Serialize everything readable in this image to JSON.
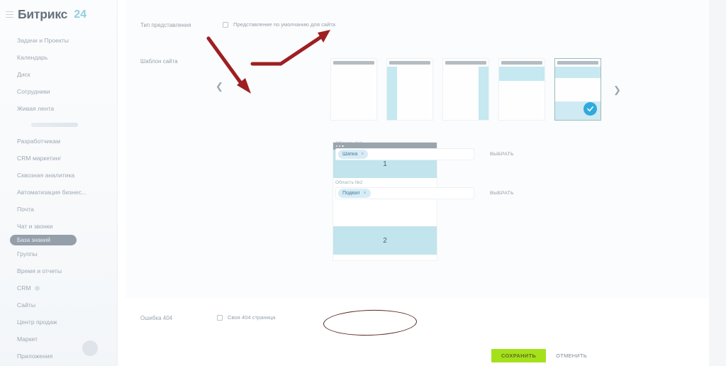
{
  "sidebar": {
    "logo": {
      "name": "Битрикс",
      "suffix": "24"
    },
    "items": [
      {
        "label": "Задачи и Проекты",
        "active": false,
        "badge": false
      },
      {
        "label": "Календарь",
        "active": false,
        "badge": false
      },
      {
        "label": "Диск",
        "active": false,
        "badge": false
      },
      {
        "label": "Сотрудники",
        "active": false,
        "badge": false
      },
      {
        "label": "Живая лента",
        "active": false,
        "badge": false
      },
      {
        "label": "Разработчикам",
        "active": false,
        "badge": false
      },
      {
        "label": "CRM маркетинг",
        "active": false,
        "badge": false
      },
      {
        "label": "Сквозная аналитика",
        "active": false,
        "badge": false
      },
      {
        "label": "Автоматизация бизнес...",
        "active": false,
        "badge": false
      },
      {
        "label": "Почта",
        "active": false,
        "badge": false
      },
      {
        "label": "Чат и звонки",
        "active": false,
        "badge": false
      },
      {
        "label": "База знаний",
        "active": true,
        "badge": false
      },
      {
        "label": "Группы",
        "active": false,
        "badge": false
      },
      {
        "label": "Время и отчеты",
        "active": false,
        "badge": false
      },
      {
        "label": "CRM",
        "active": false,
        "badge": true
      },
      {
        "label": "Сайты",
        "active": false,
        "badge": false
      },
      {
        "label": "Центр продаж",
        "active": false,
        "badge": false
      },
      {
        "label": "Маркет",
        "active": false,
        "badge": false
      },
      {
        "label": "Приложения",
        "active": false,
        "badge": false
      }
    ]
  },
  "form": {
    "view_type": {
      "label": "Тип представления",
      "checkbox_label": "Представление по умолчанию для сайта",
      "checked": false
    },
    "site_template": {
      "label": "Шаблон сайта",
      "prev_icon": "chevron-left-icon",
      "next_icon": "chevron-right-icon",
      "selected_index": 4,
      "thumbnails": [
        {
          "layout": "plain"
        },
        {
          "layout": "left-sidebar"
        },
        {
          "layout": "right-sidebar"
        },
        {
          "layout": "top-band"
        },
        {
          "layout": "header-footer"
        }
      ]
    },
    "preview": {
      "zones": [
        {
          "number": "1"
        },
        {
          "number": "2"
        }
      ]
    },
    "areas": [
      {
        "title": "Область №1",
        "chip": "Шапка",
        "chip_remove": "×",
        "select_label": "ВЫБРАТЬ"
      },
      {
        "title": "Область №2",
        "chip": "Подвал",
        "chip_remove": "×",
        "select_label": "ВЫБРАТЬ"
      }
    ],
    "error_404": {
      "label": "Ошибка 404",
      "checkbox_label": "Своя 404 страница",
      "checked": false
    }
  },
  "footer": {
    "save_label": "СОХРАНИТЬ",
    "cancel_label": "ОТМЕНИТЬ"
  },
  "annotations": {
    "arrow_color": "#9e1f22",
    "ellipse_color": "#5e2626",
    "accent_color": "#30aadc",
    "save_color": "#a5e11a"
  }
}
